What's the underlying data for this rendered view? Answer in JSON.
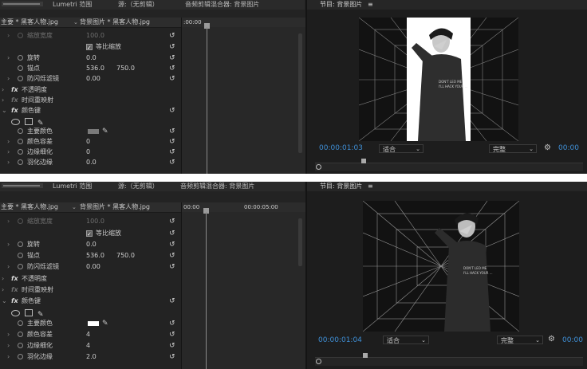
{
  "top": {
    "tabs": {
      "lumetri": "Lumetri 范围",
      "source": "源:（无剪辑）",
      "mixer": "音频剪辑混合器: 背景图片"
    },
    "clip": {
      "main": "主要 * 黑客人物.jpg",
      "seq": "背景图片 * 黑客人物.jpg"
    },
    "ruler": {
      "t0": ":00:00"
    },
    "rows": {
      "scale_width": {
        "label": "缩放宽度",
        "value": "100.0"
      },
      "uniform_scale": "等比缩放",
      "rotation": {
        "label": "旋转",
        "value": "0.0"
      },
      "anchor": {
        "label": "锚点",
        "x": "536.0",
        "y": "750.0"
      },
      "antiflicker": {
        "label": "防闪烁滤镜",
        "value": "0.00"
      },
      "opacity": "不透明度",
      "timeremap": "时间重映射",
      "colorkey": "颜色键",
      "keycolor": "主要颜色",
      "tolerance": {
        "label": "颜色容差",
        "value": "0"
      },
      "thin": {
        "label": "边缘细化",
        "value": "0"
      },
      "feather": {
        "label": "羽化边缘",
        "value": "0.0"
      }
    },
    "monitor": {
      "title": "节目: 背景图片",
      "timecode": "00:00:01:03",
      "fit": "适合",
      "quality": "完整",
      "timecode_right": "00:00"
    },
    "colors": {
      "key": "#7a7a7a"
    }
  },
  "bottom": {
    "tabs": {
      "lumetri": "Lumetri 范围",
      "source": "源:（无剪辑）",
      "mixer": "音频剪辑混合器: 背景图片"
    },
    "clip": {
      "main": "主要 * 黑客人物.jpg",
      "seq": "背景图片 * 黑客人物.jpg"
    },
    "ruler": {
      "t0": "00:00",
      "t1": "00:00:05:00"
    },
    "rows": {
      "scale_width": {
        "label": "缩放宽度",
        "value": "100.0"
      },
      "uniform_scale": "等比缩放",
      "rotation": {
        "label": "旋转",
        "value": "0.0"
      },
      "anchor": {
        "label": "锚点",
        "x": "536.0",
        "y": "750.0"
      },
      "antiflicker": {
        "label": "防闪烁滤镜",
        "value": "0.00"
      },
      "opacity": "不透明度",
      "timeremap": "时间重映射",
      "colorkey": "颜色键",
      "keycolor": "主要颜色",
      "tolerance": {
        "label": "颜色容差",
        "value": "4"
      },
      "thin": {
        "label": "边缘细化",
        "value": "4"
      },
      "feather": {
        "label": "羽化边缘",
        "value": "2.0"
      }
    },
    "monitor": {
      "title": "节目: 背景图片",
      "timecode": "00:00:01:04",
      "fit": "适合",
      "quality": "完整",
      "timecode_right": "00:00"
    },
    "colors": {
      "key": "#ffffff"
    }
  },
  "icons": {
    "reset": "↺",
    "dropper": "✎",
    "fx": "fx",
    "twirl": "›",
    "wrench": "🔧",
    "menu": "≡"
  },
  "shirt_text": {
    "line1": "DON'T LEO ME",
    "line2": "I'LL HACK YOUR ..."
  }
}
